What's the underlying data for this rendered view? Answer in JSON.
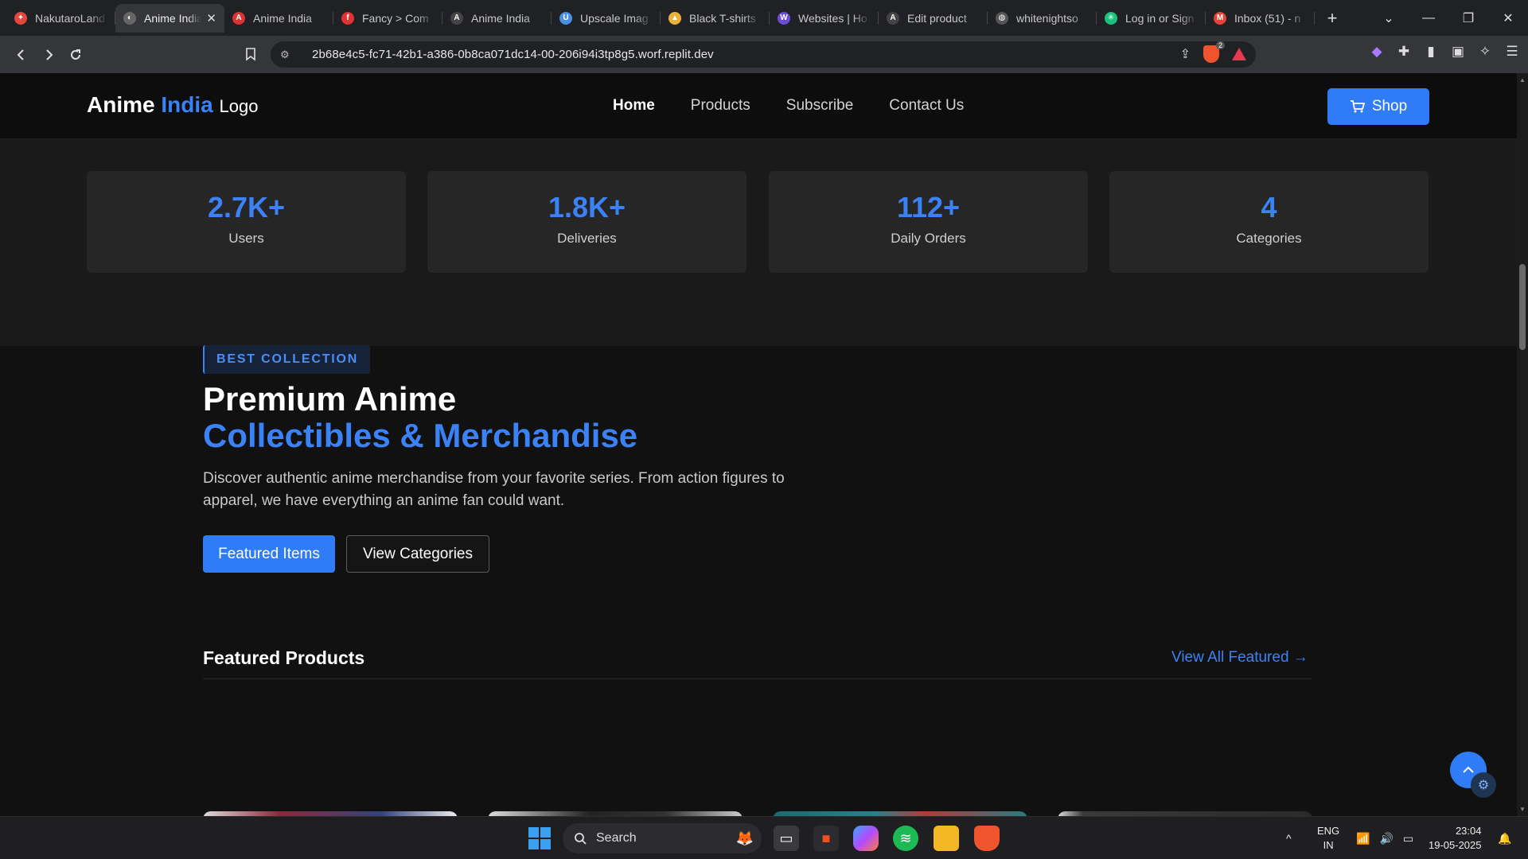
{
  "browser": {
    "tabs": [
      {
        "title": "NakutaroLand",
        "color": "#e0493b",
        "glyph": "✦"
      },
      {
        "title": "Anime India",
        "color": "#666",
        "glyph": "◐",
        "active": true
      },
      {
        "title": "Anime India",
        "color": "#d33",
        "glyph": "A"
      },
      {
        "title": "Fancy > Com",
        "color": "#d33",
        "glyph": "f"
      },
      {
        "title": "Anime India",
        "color": "#444",
        "glyph": "A"
      },
      {
        "title": "Upscale Imag",
        "color": "#4a90e2",
        "glyph": "U"
      },
      {
        "title": "Black T-shirts",
        "color": "#e9b23c",
        "glyph": "▲"
      },
      {
        "title": "Websites | Ho",
        "color": "#6b4bd8",
        "glyph": "W"
      },
      {
        "title": "Edit product",
        "color": "#444",
        "glyph": "A"
      },
      {
        "title": "whitenightso",
        "color": "#555",
        "glyph": "◍"
      },
      {
        "title": "Log in or Sign",
        "color": "#19c37d",
        "glyph": "✳"
      },
      {
        "title": "Inbox (51) - n",
        "color": "#ea4335",
        "glyph": "M"
      }
    ],
    "url": "2b68e4c5-fc71-42b1-a386-0b8ca071dc14-00-206i94i3tp8g5.worf.replit.dev",
    "brave_badge": "2"
  },
  "site": {
    "logo": {
      "part1": "Anime",
      "part2": "India",
      "part3": "Logo"
    },
    "nav": [
      "Home",
      "Products",
      "Subscribe",
      "Contact Us"
    ],
    "shop_label": "Shop",
    "stats": [
      {
        "value": "2.7K+",
        "label": "Users"
      },
      {
        "value": "1.8K+",
        "label": "Deliveries"
      },
      {
        "value": "112+",
        "label": "Daily Orders"
      },
      {
        "value": "4",
        "label": "Categories"
      }
    ],
    "hero": {
      "badge": "BEST COLLECTION",
      "title_line1": "Premium Anime",
      "title_line2": "Collectibles & Merchandise",
      "description": "Discover authentic anime merchandise from your favorite series. From action figures to apparel, we have everything an anime fan could want.",
      "primary_button": "Featured Items",
      "secondary_button": "View Categories"
    },
    "featured": {
      "heading": "Featured Products",
      "view_all": "View All Featured →"
    },
    "colors": {
      "accent": "#3b82f6",
      "background": "#111111"
    }
  },
  "taskbar": {
    "search_label": "Search",
    "language": "ENG",
    "region": "IN",
    "time": "23:04",
    "date": "19-05-2025"
  }
}
